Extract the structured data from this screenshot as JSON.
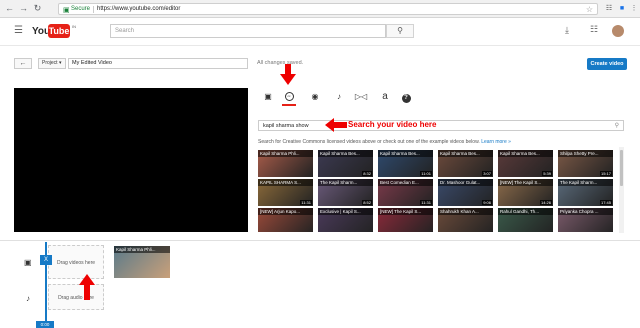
{
  "browser": {
    "secure_label": "Secure",
    "url": "https://www.youtube.com/editor"
  },
  "header": {
    "logo_you": "You",
    "logo_tube": "Tube",
    "logo_country": "IN",
    "search_placeholder": "Search"
  },
  "editor": {
    "project_label": "Project",
    "project_title": "My Edited Video",
    "status": "All changes saved.",
    "create_label": "Create video"
  },
  "tabs": [
    {
      "name": "videos",
      "icon": "video-camera-icon"
    },
    {
      "name": "creative-commons",
      "icon": "cc-icon",
      "active": true
    },
    {
      "name": "photos",
      "icon": "camera-icon"
    },
    {
      "name": "audio",
      "icon": "music-icon"
    },
    {
      "name": "transitions",
      "icon": "transition-icon"
    },
    {
      "name": "text",
      "icon": "text-icon",
      "glyph": "a"
    },
    {
      "name": "help",
      "icon": "help-icon",
      "glyph": "?"
    }
  ],
  "annotation": {
    "search_note": "Search your video here"
  },
  "cc": {
    "search_value": "kapil sharma show",
    "hint": "Search for Creative Commons licensed videos above or check out one of the example videos below.",
    "learn_more": "Learn more »"
  },
  "results": [
    {
      "title": "Kapil Sharma Phli...",
      "duration": "",
      "color": "#a85c4a"
    },
    {
      "title": "Kapil Sharma Bes...",
      "duration": "8:32",
      "color": "#3c3a52"
    },
    {
      "title": "Kapil Sharma Bes...",
      "duration": "11:01",
      "color": "#2f4a6e"
    },
    {
      "title": "Kapil Sharma Bes...",
      "duration": "3:07",
      "color": "#6c4a3c"
    },
    {
      "title": "Kapil Sharma Bes...",
      "duration": "5:39",
      "color": "#5a3a3a"
    },
    {
      "title": "Shilpa Shetty Pre...",
      "duration": "15:17",
      "color": "#7a5846"
    },
    {
      "title": "KAPIL SHARMA S...",
      "duration": "11:31",
      "color": "#8b6a3a"
    },
    {
      "title": "The Kapil Sharm...",
      "duration": "8:52",
      "color": "#6a5a7a"
    },
    {
      "title": "Best Comedian E...",
      "duration": "11:31",
      "color": "#7a3a4a"
    },
    {
      "title": "Dr. Mashoor Gulat...",
      "duration": "9:06",
      "color": "#3a4a6a"
    },
    {
      "title": "[NEW] The Kapil S...",
      "duration": "14:26",
      "color": "#8a6a4a"
    },
    {
      "title": "The Kapil Sharm...",
      "duration": "17:45",
      "color": "#5a6a7a"
    },
    {
      "title": "[NEW] Arjun Kapo...",
      "duration": "",
      "color": "#9a4a3a"
    },
    {
      "title": "Exclusive | Kapil S...",
      "duration": "",
      "color": "#4a3a5a"
    },
    {
      "title": "[NEW] The Kapil S...",
      "duration": "",
      "color": "#8a2a3a"
    },
    {
      "title": "Shahrukh Khan A...",
      "duration": "",
      "color": "#6a4a3a"
    },
    {
      "title": "Rahul Gandhi, Th...",
      "duration": "",
      "color": "#3a5a4a"
    },
    {
      "title": "Priyanka Chopra ...",
      "duration": "",
      "color": "#7a5a6a"
    }
  ],
  "timeline": {
    "drop_video": "Drag videos here",
    "drop_audio": "Drag audio here",
    "clip_title": "Kapil Sharma Phli...",
    "clip_color": "#5a7a8a",
    "playhead_marker": "X",
    "time": "0:00"
  },
  "colors": {
    "accent": "#167ac6",
    "youtube_red": "#e62117",
    "annotation_red": "#e00000"
  }
}
